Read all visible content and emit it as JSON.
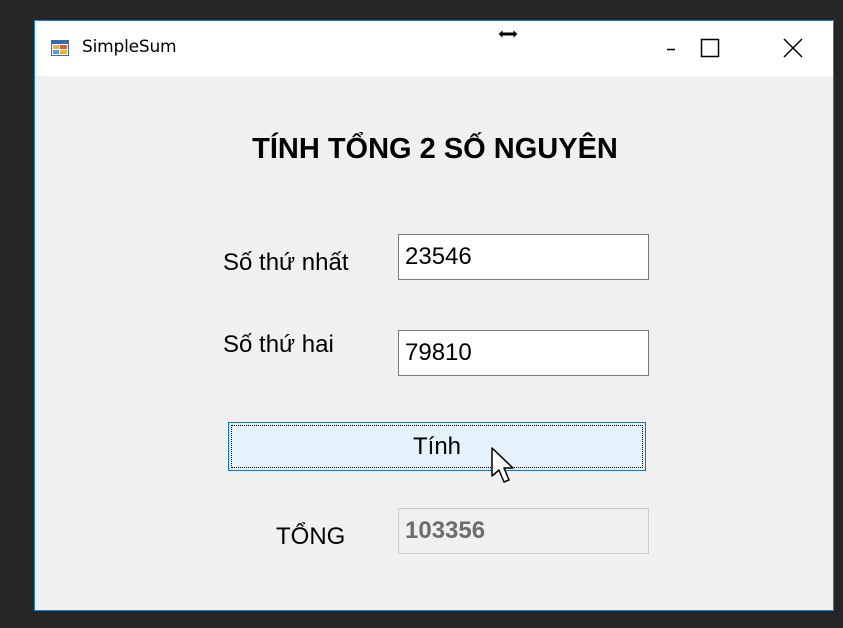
{
  "window": {
    "title": "SimpleSum",
    "app_icon": "winforms-app-icon",
    "caption_buttons": {
      "minimize_icon": "minimize-icon",
      "maximize_icon": "maximize-icon",
      "close_icon": "close-icon"
    },
    "accent_color": "#1883d7"
  },
  "form": {
    "heading": "TÍNH TỔNG 2 SỐ NGUYÊN",
    "first_label": "Số thứ nhất",
    "first_value": "23546",
    "second_label": "Số thứ hai",
    "second_value": "79810",
    "calc_button_label": "Tính",
    "result_label": "TỔNG",
    "result_value": "103356"
  },
  "cursor": {
    "type": "arrow",
    "overlay": "horizontal-resize-cursor"
  }
}
